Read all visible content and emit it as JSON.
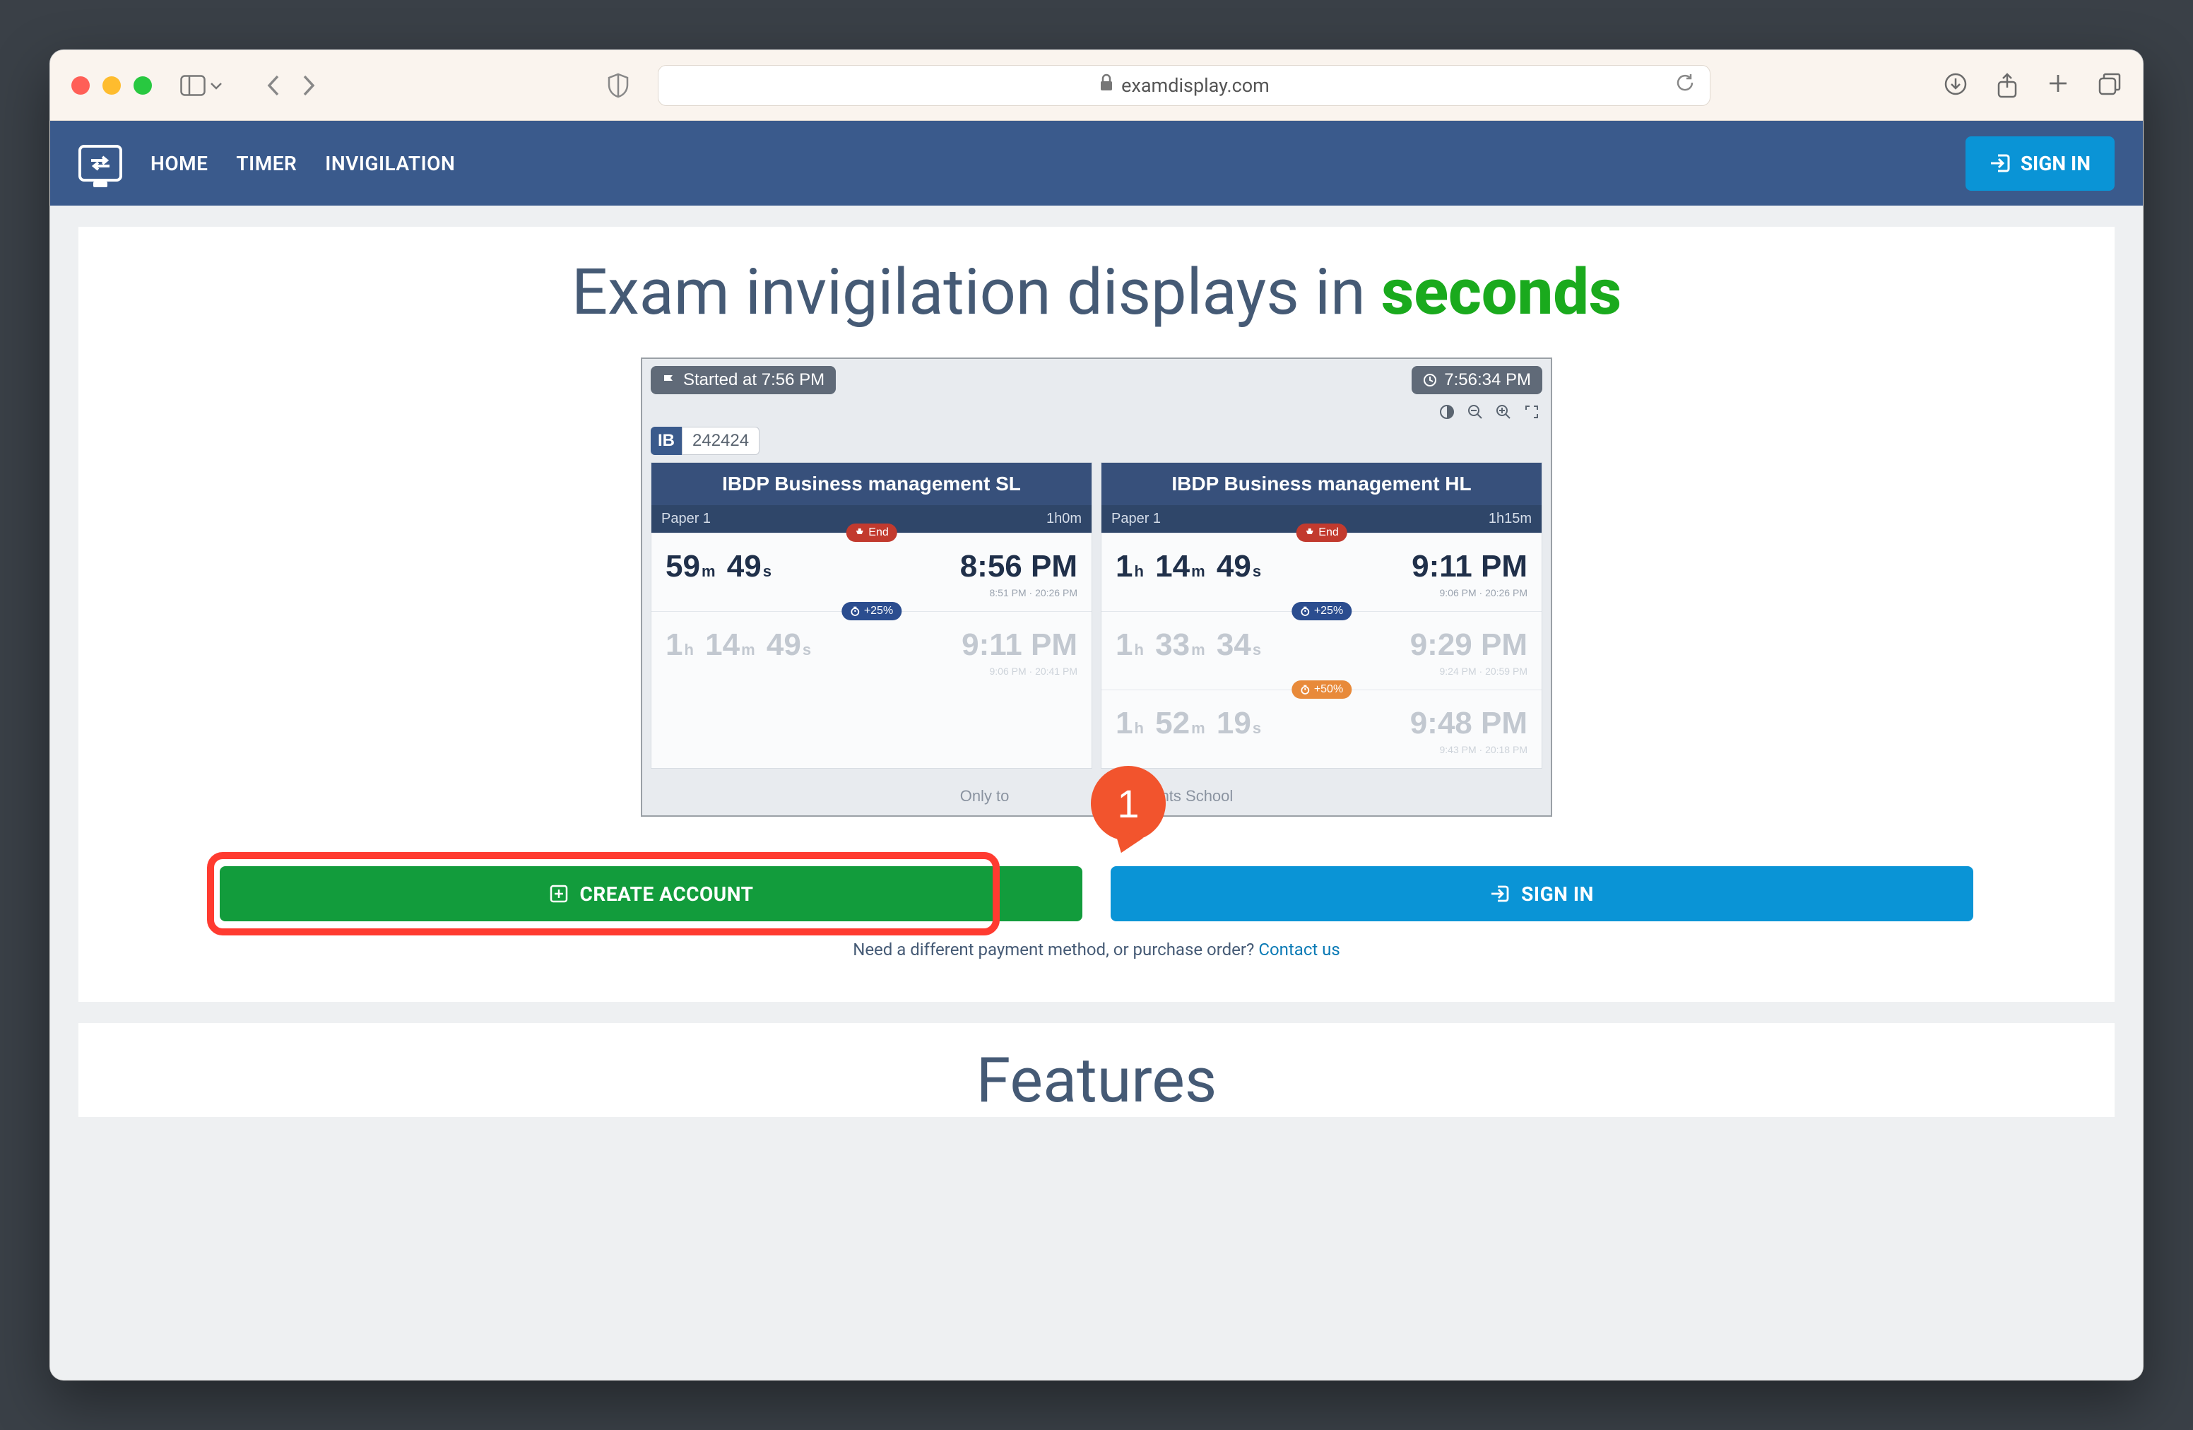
{
  "chrome": {
    "url_display": "examdisplay.com"
  },
  "nav": {
    "links": [
      "HOME",
      "TIMER",
      "INVIGILATION"
    ],
    "signin": "SIGN IN"
  },
  "hero": {
    "title_prefix": "Exam invigilation displays in ",
    "title_accent": "seconds"
  },
  "preview": {
    "started_label": "Started at 7:56 PM",
    "clock": "7:56:34 PM",
    "session_code": "242424",
    "session_prefix": "IB",
    "footer_prefix": "Only to",
    "footer_suffix": "Hill Heights School",
    "panels": [
      {
        "title": "IBDP Business management SL",
        "paper": "Paper 1",
        "duration": "1h0m",
        "rows": [
          {
            "tag": "End",
            "tag_color": "red",
            "dim": false,
            "remain": [
              [
                "59",
                "m"
              ],
              [
                "49",
                "s"
              ]
            ],
            "end": "8:56 PM",
            "fine": "8:51 PM · 20:26 PM"
          },
          {
            "tag": "+25%",
            "tag_color": "blue",
            "dim": true,
            "remain": [
              [
                "1",
                "h"
              ],
              [
                "14",
                "m"
              ],
              [
                "49",
                "s"
              ]
            ],
            "end": "9:11 PM",
            "fine": "9:06 PM · 20:41 PM"
          }
        ]
      },
      {
        "title": "IBDP Business management HL",
        "paper": "Paper 1",
        "duration": "1h15m",
        "rows": [
          {
            "tag": "End",
            "tag_color": "red",
            "dim": false,
            "remain": [
              [
                "1",
                "h"
              ],
              [
                "14",
                "m"
              ],
              [
                "49",
                "s"
              ]
            ],
            "end": "9:11 PM",
            "fine": "9:06 PM · 20:26 PM"
          },
          {
            "tag": "+25%",
            "tag_color": "blue",
            "dim": true,
            "remain": [
              [
                "1",
                "h"
              ],
              [
                "33",
                "m"
              ],
              [
                "34",
                "s"
              ]
            ],
            "end": "9:29 PM",
            "fine": "9:24 PM · 20:59 PM"
          },
          {
            "tag": "+50%",
            "tag_color": "orange",
            "dim": true,
            "remain": [
              [
                "1",
                "h"
              ],
              [
                "52",
                "m"
              ],
              [
                "19",
                "s"
              ]
            ],
            "end": "9:48 PM",
            "fine": "9:43 PM · 20:18 PM"
          }
        ]
      }
    ]
  },
  "annotation": {
    "number": "1"
  },
  "cta": {
    "create": "CREATE ACCOUNT",
    "signin": "SIGN IN",
    "subline_prefix": "Need a different payment method, or purchase order? ",
    "subline_link": "Contact us"
  },
  "features": {
    "heading": "Features"
  }
}
